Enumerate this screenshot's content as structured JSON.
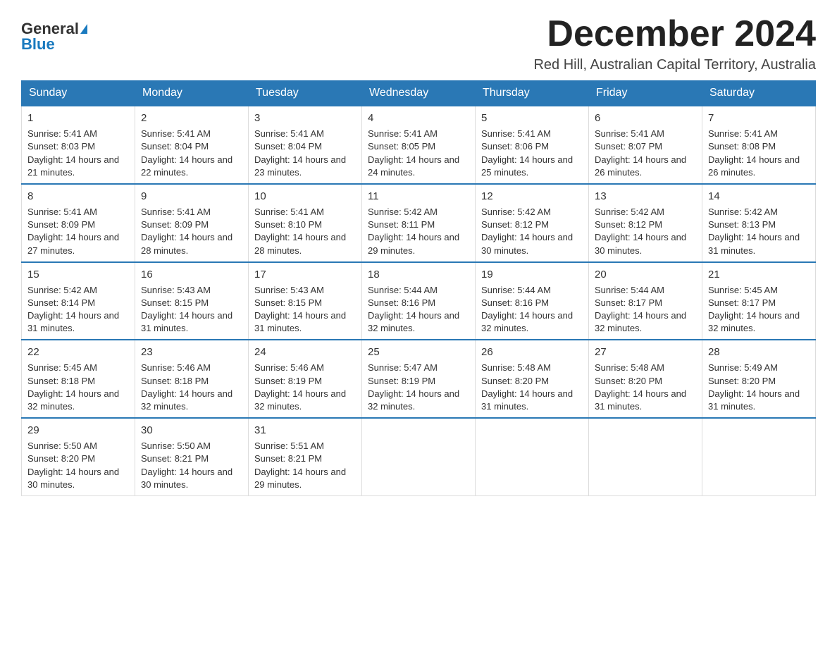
{
  "logo": {
    "general": "General",
    "blue": "Blue"
  },
  "header": {
    "month": "December 2024",
    "location": "Red Hill, Australian Capital Territory, Australia"
  },
  "days_of_week": [
    "Sunday",
    "Monday",
    "Tuesday",
    "Wednesday",
    "Thursday",
    "Friday",
    "Saturday"
  ],
  "weeks": [
    [
      {
        "day": "1",
        "sunrise": "5:41 AM",
        "sunset": "8:03 PM",
        "daylight": "14 hours and 21 minutes."
      },
      {
        "day": "2",
        "sunrise": "5:41 AM",
        "sunset": "8:04 PM",
        "daylight": "14 hours and 22 minutes."
      },
      {
        "day": "3",
        "sunrise": "5:41 AM",
        "sunset": "8:04 PM",
        "daylight": "14 hours and 23 minutes."
      },
      {
        "day": "4",
        "sunrise": "5:41 AM",
        "sunset": "8:05 PM",
        "daylight": "14 hours and 24 minutes."
      },
      {
        "day": "5",
        "sunrise": "5:41 AM",
        "sunset": "8:06 PM",
        "daylight": "14 hours and 25 minutes."
      },
      {
        "day": "6",
        "sunrise": "5:41 AM",
        "sunset": "8:07 PM",
        "daylight": "14 hours and 26 minutes."
      },
      {
        "day": "7",
        "sunrise": "5:41 AM",
        "sunset": "8:08 PM",
        "daylight": "14 hours and 26 minutes."
      }
    ],
    [
      {
        "day": "8",
        "sunrise": "5:41 AM",
        "sunset": "8:09 PM",
        "daylight": "14 hours and 27 minutes."
      },
      {
        "day": "9",
        "sunrise": "5:41 AM",
        "sunset": "8:09 PM",
        "daylight": "14 hours and 28 minutes."
      },
      {
        "day": "10",
        "sunrise": "5:41 AM",
        "sunset": "8:10 PM",
        "daylight": "14 hours and 28 minutes."
      },
      {
        "day": "11",
        "sunrise": "5:42 AM",
        "sunset": "8:11 PM",
        "daylight": "14 hours and 29 minutes."
      },
      {
        "day": "12",
        "sunrise": "5:42 AM",
        "sunset": "8:12 PM",
        "daylight": "14 hours and 30 minutes."
      },
      {
        "day": "13",
        "sunrise": "5:42 AM",
        "sunset": "8:12 PM",
        "daylight": "14 hours and 30 minutes."
      },
      {
        "day": "14",
        "sunrise": "5:42 AM",
        "sunset": "8:13 PM",
        "daylight": "14 hours and 31 minutes."
      }
    ],
    [
      {
        "day": "15",
        "sunrise": "5:42 AM",
        "sunset": "8:14 PM",
        "daylight": "14 hours and 31 minutes."
      },
      {
        "day": "16",
        "sunrise": "5:43 AM",
        "sunset": "8:15 PM",
        "daylight": "14 hours and 31 minutes."
      },
      {
        "day": "17",
        "sunrise": "5:43 AM",
        "sunset": "8:15 PM",
        "daylight": "14 hours and 31 minutes."
      },
      {
        "day": "18",
        "sunrise": "5:44 AM",
        "sunset": "8:16 PM",
        "daylight": "14 hours and 32 minutes."
      },
      {
        "day": "19",
        "sunrise": "5:44 AM",
        "sunset": "8:16 PM",
        "daylight": "14 hours and 32 minutes."
      },
      {
        "day": "20",
        "sunrise": "5:44 AM",
        "sunset": "8:17 PM",
        "daylight": "14 hours and 32 minutes."
      },
      {
        "day": "21",
        "sunrise": "5:45 AM",
        "sunset": "8:17 PM",
        "daylight": "14 hours and 32 minutes."
      }
    ],
    [
      {
        "day": "22",
        "sunrise": "5:45 AM",
        "sunset": "8:18 PM",
        "daylight": "14 hours and 32 minutes."
      },
      {
        "day": "23",
        "sunrise": "5:46 AM",
        "sunset": "8:18 PM",
        "daylight": "14 hours and 32 minutes."
      },
      {
        "day": "24",
        "sunrise": "5:46 AM",
        "sunset": "8:19 PM",
        "daylight": "14 hours and 32 minutes."
      },
      {
        "day": "25",
        "sunrise": "5:47 AM",
        "sunset": "8:19 PM",
        "daylight": "14 hours and 32 minutes."
      },
      {
        "day": "26",
        "sunrise": "5:48 AM",
        "sunset": "8:20 PM",
        "daylight": "14 hours and 31 minutes."
      },
      {
        "day": "27",
        "sunrise": "5:48 AM",
        "sunset": "8:20 PM",
        "daylight": "14 hours and 31 minutes."
      },
      {
        "day": "28",
        "sunrise": "5:49 AM",
        "sunset": "8:20 PM",
        "daylight": "14 hours and 31 minutes."
      }
    ],
    [
      {
        "day": "29",
        "sunrise": "5:50 AM",
        "sunset": "8:20 PM",
        "daylight": "14 hours and 30 minutes."
      },
      {
        "day": "30",
        "sunrise": "5:50 AM",
        "sunset": "8:21 PM",
        "daylight": "14 hours and 30 minutes."
      },
      {
        "day": "31",
        "sunrise": "5:51 AM",
        "sunset": "8:21 PM",
        "daylight": "14 hours and 29 minutes."
      },
      null,
      null,
      null,
      null
    ]
  ],
  "labels": {
    "sunrise": "Sunrise:",
    "sunset": "Sunset:",
    "daylight": "Daylight:"
  },
  "colors": {
    "header_bg": "#2a78b5",
    "header_text": "#ffffff"
  }
}
